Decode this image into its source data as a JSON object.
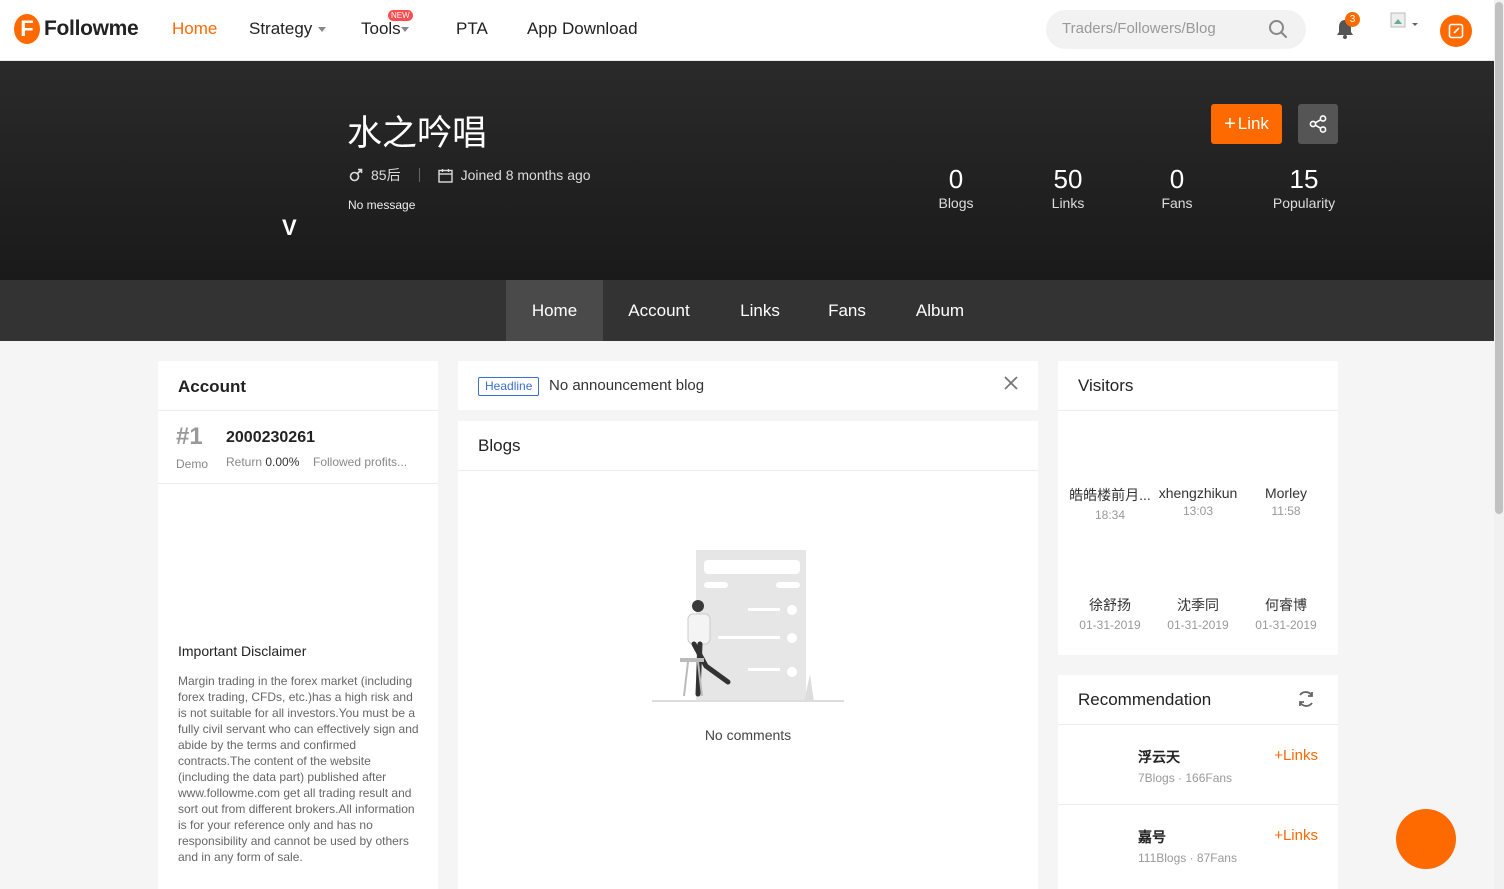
{
  "nav": {
    "logo_letter": "F",
    "logo_text": "Followme",
    "items": [
      {
        "label": "Home",
        "active": true
      },
      {
        "label": "Strategy"
      },
      {
        "label": "Tools",
        "badge": "NEW"
      },
      {
        "label": "PTA"
      },
      {
        "label": "App Download"
      }
    ],
    "search_placeholder": "Traders/Followers/Blog",
    "notification_count": "3",
    "accent_color": "#ff6a00"
  },
  "profile": {
    "name": "水之吟唱",
    "age_tag": "85后",
    "joined": "Joined 8 months ago",
    "message": "No message",
    "verified_letter": "V",
    "link_button": "Link",
    "stats": [
      {
        "value": "0",
        "label": "Blogs"
      },
      {
        "value": "50",
        "label": "Links"
      },
      {
        "value": "0",
        "label": "Fans"
      },
      {
        "value": "15",
        "label": "Popularity"
      }
    ]
  },
  "tabs": [
    "Home",
    "Account",
    "Links",
    "Fans",
    "Album"
  ],
  "account": {
    "title": "Account",
    "rank": "#1",
    "type": "Demo",
    "number": "2000230261",
    "return_label": "Return",
    "return_value": "0.00%",
    "followed": "Followed profits...",
    "disclaimer_title": "Important Disclaimer",
    "disclaimer_text": "Margin trading in the forex market (including forex trading, CFDs, etc.)has a high risk and is not suitable for all investors.You must be a fully civil servant who can effectively sign and abide by the terms and confirmed contracts.The content of the website (including the data part) published after www.followme.com get all trading result and sort out from different brokers.All information is for your reference only and has no responsibility and cannot be used by others and in any form of sale."
  },
  "announcement": {
    "tag": "Headline",
    "text": "No announcement blog"
  },
  "blogs": {
    "title": "Blogs",
    "empty_text": "No comments"
  },
  "visitors": {
    "title": "Visitors",
    "items": [
      {
        "name": "皓皓楼前月...",
        "time": "18:34"
      },
      {
        "name": "xhengzhikun",
        "time": "13:03"
      },
      {
        "name": "Morley",
        "time": "11:58"
      },
      {
        "name": "徐舒扬",
        "time": "01-31-2019"
      },
      {
        "name": "沈季同",
        "time": "01-31-2019"
      },
      {
        "name": "何睿博",
        "time": "01-31-2019"
      }
    ]
  },
  "recommendation": {
    "title": "Recommendation",
    "items": [
      {
        "name": "浮云天",
        "meta": "7Blogs · 166Fans",
        "action": "Links"
      },
      {
        "name": "嘉号",
        "meta": "111Blogs · 87Fans",
        "action": "Links"
      }
    ]
  }
}
